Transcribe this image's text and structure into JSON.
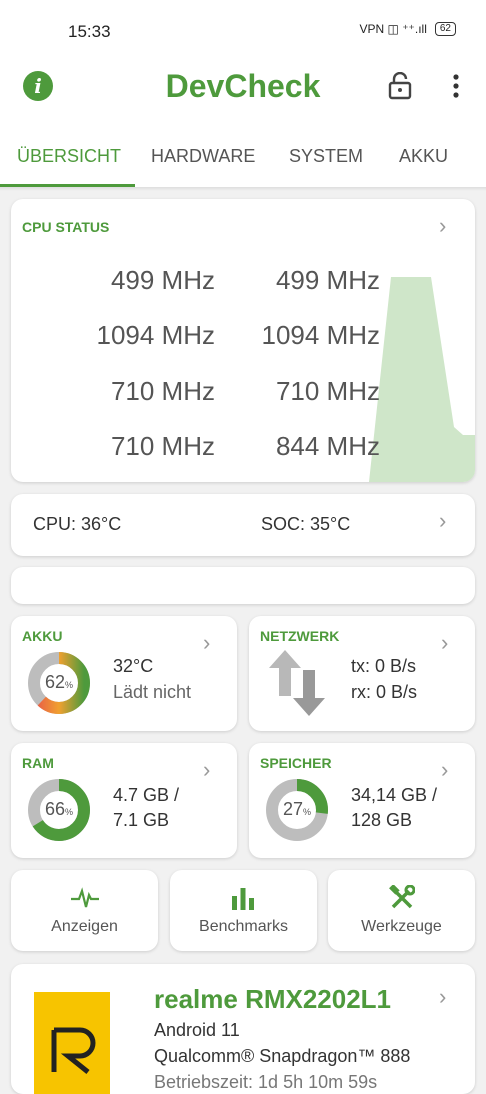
{
  "status_bar": {
    "time": "15:33",
    "icons": "VPN ◫ ⁺⁺.ıll",
    "battery": "62"
  },
  "app": {
    "title": "DevCheck",
    "info_icon": "i"
  },
  "tabs": [
    "ÜBERSICHT",
    "HARDWARE",
    "SYSTEM",
    "AKKU"
  ],
  "cpu": {
    "title": "CPU STATUS",
    "freqs": [
      "499 MHz",
      "499 MHz",
      "1094 MHz",
      "1094 MHz",
      "710 MHz",
      "710 MHz",
      "710 MHz",
      "844 MHz"
    ]
  },
  "temps": {
    "cpu": "CPU: 36°C",
    "soc": "SOC: 35°C"
  },
  "battery": {
    "title": "AKKU",
    "percent": "62",
    "percent_value": 62,
    "temp": "32°C",
    "state": "Lädt nicht"
  },
  "network": {
    "title": "NETZWERK",
    "tx": "tx: 0 B/s",
    "rx": "rx: 0 B/s"
  },
  "ram": {
    "title": "RAM",
    "percent": "66",
    "percent_value": 66,
    "used": "4.7 GB /",
    "total": "7.1 GB"
  },
  "storage": {
    "title": "SPEICHER",
    "percent": "27",
    "percent_value": 27,
    "used": "34,14 GB /",
    "total": "128 GB"
  },
  "actions": {
    "show": "Anzeigen",
    "bench": "Benchmarks",
    "tools": "Werkzeuge"
  },
  "device": {
    "name": "realme RMX2202L1",
    "android": "Android 11",
    "soc": "Qualcomm® Snapdragon™ 888",
    "uptime": "Betriebszeit: 1d 5h 10m 59s"
  },
  "colors": {
    "accent": "#4e9a3c",
    "chart_fill": "#cfe6c9",
    "ring_bg": "#bdbdbd"
  }
}
